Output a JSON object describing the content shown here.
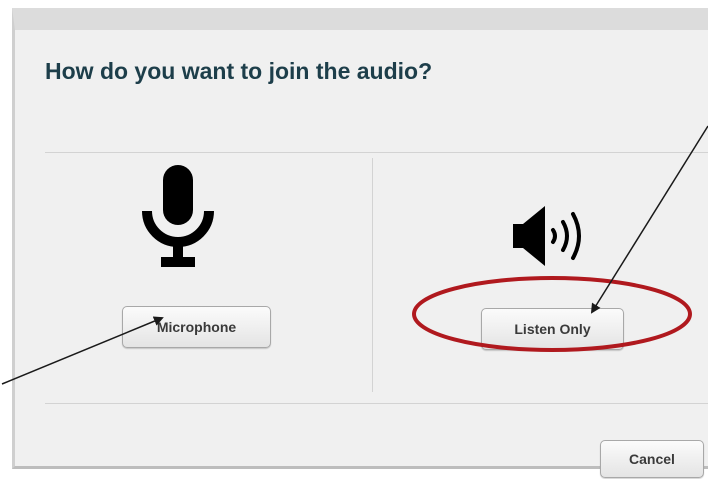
{
  "dialog": {
    "title": "How do you want to join the audio?"
  },
  "options": {
    "microphone": {
      "label": "Microphone",
      "icon": "microphone-icon"
    },
    "listen_only": {
      "label": "Listen Only",
      "icon": "speaker-icon"
    }
  },
  "footer": {
    "cancel_label": "Cancel"
  },
  "annotations": {
    "highlight_color": "#b0191e",
    "arrow_color": "#1a1a1a"
  }
}
